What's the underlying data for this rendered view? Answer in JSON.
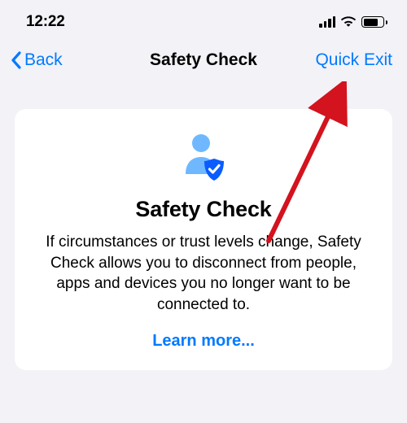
{
  "status": {
    "time": "12:22"
  },
  "nav": {
    "back_label": "Back",
    "title": "Safety Check",
    "quick_exit_label": "Quick Exit"
  },
  "card": {
    "title": "Safety Check",
    "description": "If circumstances or trust levels change, Safety Check allows you to disconnect from people, apps and devices you no longer want to be connected to.",
    "learn_more_label": "Learn more..."
  },
  "colors": {
    "accent": "#007aff",
    "background": "#f2f2f7",
    "annotation_arrow": "#d3131e"
  }
}
